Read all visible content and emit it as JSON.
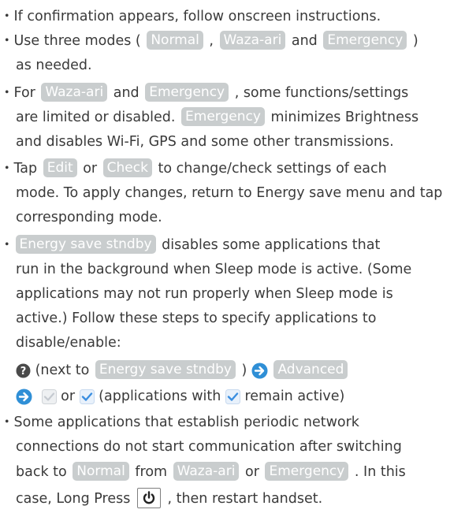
{
  "bullet": "・",
  "lines": {
    "l1": "If confirmation appears, follow onscreen instructions.",
    "l2a": "Use three modes ( ",
    "l2b": " , ",
    "l2c": " and ",
    "l2d": " )",
    "l3": "as needed.",
    "l4a": "For ",
    "l4b": " and ",
    "l4c": " , some functions/settings",
    "l5a": "are limited or disabled. ",
    "l5b": " minimizes Brightness",
    "l6": "and disables Wi-Fi, GPS and some other transmissions.",
    "l7a": "Tap ",
    "l7b": " or ",
    "l7c": " to change/check settings of each",
    "l8": "mode. To apply changes, return to Energy save menu and tap",
    "l9": "corresponding mode.",
    "l10b": " disables some applications that",
    "l11": "run in the background when Sleep mode is active. (Some",
    "l12": "applications may not run properly when Sleep mode is",
    "l13": "active.) Follow these steps to specify applications to",
    "l14": "disable/enable:",
    "l15a": " (next to ",
    "l15b": " ) ",
    "l16a": " or ",
    "l16b": " (applications with ",
    "l16c": " remain active)",
    "l17": "Some applications that establish periodic network",
    "l18": "connections do not start communication after switching",
    "l19a": "back to ",
    "l19b": " from ",
    "l19c": " or ",
    "l19d": " . In this",
    "l20a": "case, Long Press ",
    "l20b": " , then restart handset."
  },
  "chips": {
    "normal": "Normal",
    "waza": "Waza-ari",
    "emergency": "Emergency",
    "edit": "Edit",
    "check": "Check",
    "standby": "Energy save stndby",
    "advanced": "Advanced"
  },
  "icons": {
    "help": "help-circle-icon",
    "arrow": "arrow-right-circle-icon",
    "unchecked": "checkbox-unchecked-icon",
    "checked": "checkbox-checked-icon",
    "power": "power-key-icon"
  },
  "colors": {
    "chip_bg": "#c9cdce",
    "arrow_blue": "#2f8fd6",
    "check_blue": "#3a8ee0",
    "text": "#3a3a3a"
  }
}
